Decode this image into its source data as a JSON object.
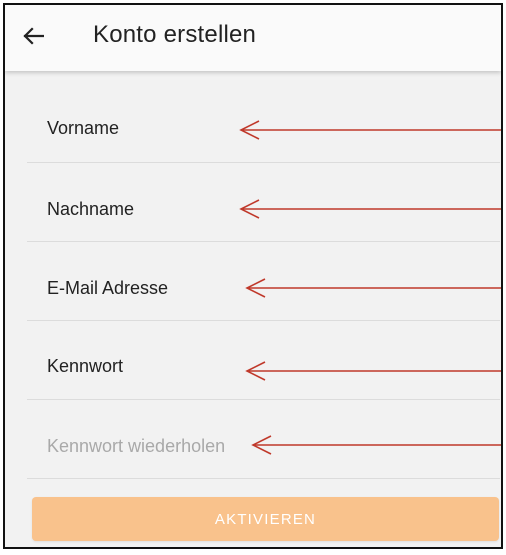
{
  "appbar": {
    "back_icon": "arrow-left-icon",
    "title": "Konto erstellen"
  },
  "form": {
    "fields": [
      {
        "key": "first_name",
        "label": "Vorname",
        "is_placeholder": false
      },
      {
        "key": "last_name",
        "label": "Nachname",
        "is_placeholder": false
      },
      {
        "key": "email",
        "label": "E-Mail Adresse",
        "is_placeholder": false
      },
      {
        "key": "password",
        "label": "Kennwort",
        "is_placeholder": false
      },
      {
        "key": "password_repeat",
        "label": "Kennwort wiederholen",
        "is_placeholder": true
      }
    ],
    "submit_label": "AKTIVIEREN"
  },
  "colors": {
    "screen_bg": "#f2f2f2",
    "appbar_bg": "#fafafa",
    "button_disabled": "#f9c28c",
    "annotation_arrow": "#c0392b"
  }
}
